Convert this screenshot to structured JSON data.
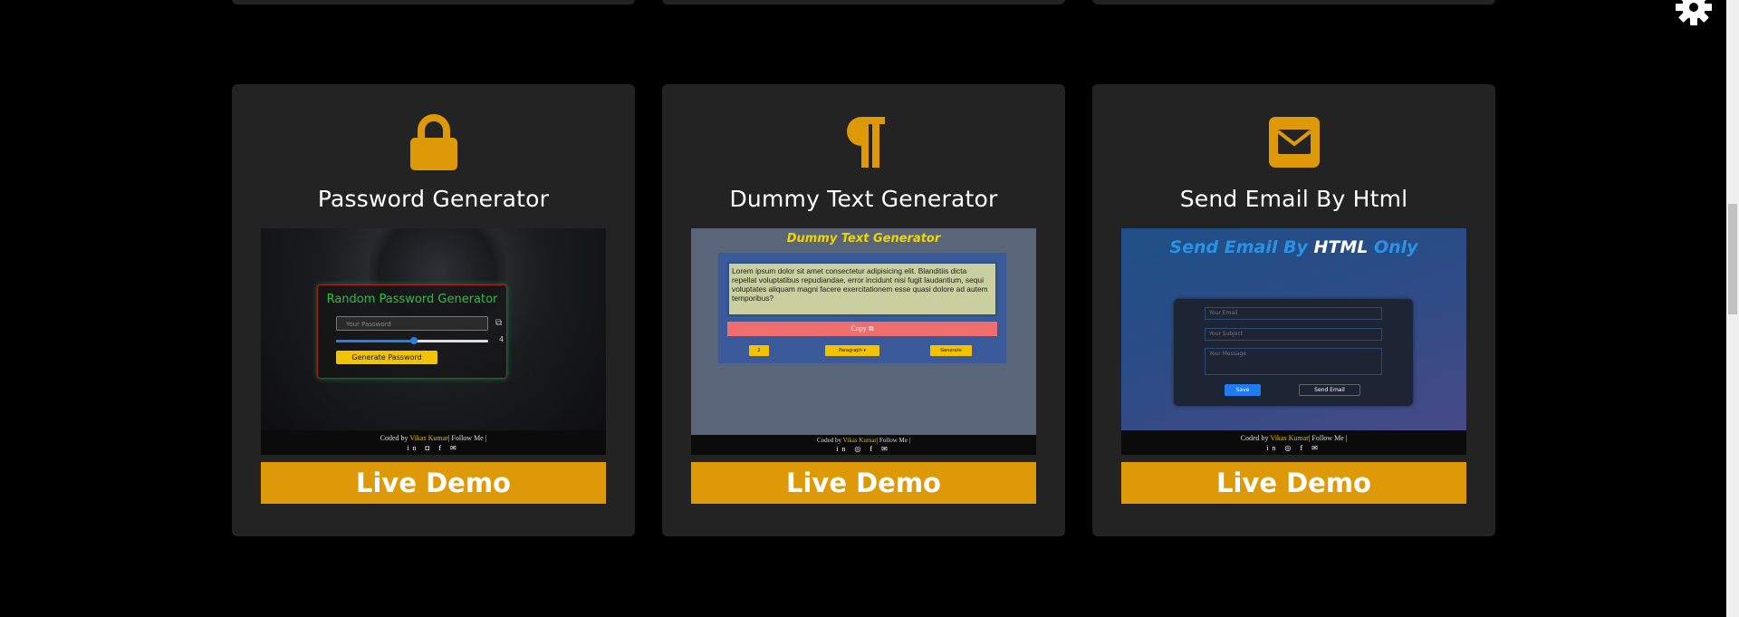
{
  "colors": {
    "accent": "#dd9907",
    "card_bg": "#232323",
    "page_bg": "#000000"
  },
  "cards": [
    {
      "icon": "lock-icon",
      "title": "Password Generator",
      "button": "Live Demo",
      "preview": {
        "heading": "Random Password Generator",
        "placeholder": "Your Password",
        "slider_value": "4",
        "button": "Generate Password",
        "footer_coded": "Coded by",
        "footer_name": "Vikas Kumar",
        "footer_follow": "| Follow Me |"
      }
    },
    {
      "icon": "paragraph-icon",
      "title": "Dummy Text Generator",
      "button": "Live Demo",
      "preview": {
        "heading": "Dummy Text Generator",
        "text": "Lorem ipsum dolor sit amet consectetur adipisicing elit. Blanditiis dicta repellat voluptatibus repudiandae, error incidunt nisi fugit laudantium, sequi voluptates aliquam magni facere exercitationem esse quasi dolore ad autem temporibus?",
        "copy": "Copy",
        "count": "2",
        "type": "Paragraph",
        "generate": "Generate",
        "footer_coded": "Coded by",
        "footer_name": "Vikas Kumar",
        "footer_follow": "| Follow Me |"
      }
    },
    {
      "icon": "envelope-icon",
      "title": "Send Email By Html",
      "button": "Live Demo",
      "preview": {
        "heading_a": "Send Email By",
        "heading_b": "HTML",
        "heading_c": "Only",
        "email": "Your Email",
        "subject": "Your Subject",
        "message": "Your Message",
        "save": "Save",
        "send": "Send Email",
        "footer_coded": "Coded by",
        "footer_name": "Vikas Kumar",
        "footer_follow": "| Follow Me |"
      }
    }
  ]
}
